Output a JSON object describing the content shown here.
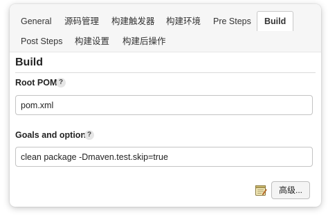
{
  "tabs": {
    "row1": [
      {
        "label": "General"
      },
      {
        "label": "源码管理"
      },
      {
        "label": "构建触发器"
      },
      {
        "label": "构建环境"
      },
      {
        "label": "Pre Steps"
      },
      {
        "label": "Build",
        "active": true
      }
    ],
    "row2": [
      {
        "label": "Post Steps"
      },
      {
        "label": "构建设置"
      },
      {
        "label": "构建后操作"
      }
    ]
  },
  "section": {
    "title": "Build"
  },
  "root_pom": {
    "label": "Root POM",
    "help": "?",
    "value": "pom.xml"
  },
  "goals": {
    "label": "Goals and options",
    "help": "?",
    "value": "clean package -Dmaven.test.skip=true"
  },
  "advanced_button": {
    "label": "高级..."
  },
  "icons": {
    "notepad": "notepad-icon"
  }
}
